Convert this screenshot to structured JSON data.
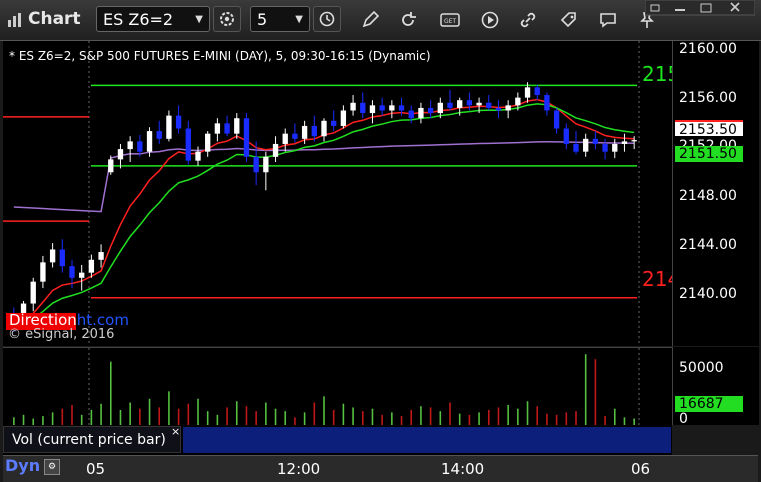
{
  "window": {
    "title": "Chart"
  },
  "toolbar": {
    "symbol_value": "ES Z6=2",
    "interval_value": "5",
    "buttons": [
      "settings-gear",
      "clock",
      "pencil-draw",
      "refresh",
      "get-quote",
      "play",
      "link",
      "comment",
      "pin"
    ]
  },
  "chart": {
    "info": "* ES Z6=2, S&P 500 FUTURES E-MINI (DAY), 5, 09:30-16:15 (Dynamic)",
    "watermark_a": "Direction",
    "watermark_b": "ht.com",
    "copyright": "© eSignal, 2016",
    "level_upper_label": "215",
    "level_lower_label": "214",
    "price_ticks": [
      "2160.00",
      "2156.00",
      "2152.00",
      "2148.00",
      "2144.00",
      "2140.00"
    ],
    "last_price": "2153.50",
    "level_price": "2151.50",
    "time_ticks": [
      "05",
      "12:00",
      "14:00",
      "06"
    ],
    "dynamic_label": "Dyn"
  },
  "volume": {
    "label": "Vol (current price bar)",
    "close": "×",
    "ticks": [
      "50000",
      "0"
    ],
    "last_volume": "16687"
  },
  "colors": {
    "up": "#ffffff",
    "down": "#1a2cff",
    "ema_red": "#ff2020",
    "ema_green": "#20e020",
    "vwap_purple": "#a070d0",
    "level_green": "#1ee61e",
    "level_red": "#ff2020",
    "vol_up": "#56c040",
    "vol_down": "#c01818"
  },
  "chart_data": {
    "type": "candlestick",
    "title": "ES Z6=2, S&P 500 FUTURES E-MINI (DAY), 5",
    "ylim": [
      2137.5,
      2161.2
    ],
    "levels": {
      "green_upper": 2157.75,
      "green_lower": 2151.5,
      "red_upper": 2155.3,
      "red_mid": 2147.2,
      "red_lower": 2141.25
    },
    "last_price": 2153.5,
    "candles": [
      [
        2139.8,
        2140.5,
        2138.6,
        2138.9
      ],
      [
        2139,
        2141,
        2138.8,
        2140.8
      ],
      [
        2140.8,
        2142.8,
        2140.2,
        2142.5
      ],
      [
        2142.5,
        2144.5,
        2142,
        2144
      ],
      [
        2144,
        2145.5,
        2143.6,
        2145
      ],
      [
        2145,
        2145.8,
        2143.2,
        2143.7
      ],
      [
        2143.7,
        2144.2,
        2142,
        2142.8
      ],
      [
        2142.8,
        2143.8,
        2141.8,
        2143.2
      ],
      [
        2143.2,
        2144.6,
        2142.8,
        2144.2
      ],
      [
        2144.2,
        2145.4,
        2143.6,
        2144.8
      ],
      [
        2151,
        2152.3,
        2150.8,
        2152
      ],
      [
        2152,
        2153.2,
        2151.3,
        2152.8
      ],
      [
        2152.8,
        2153.8,
        2151.8,
        2153.4
      ],
      [
        2153.4,
        2153.9,
        2152.2,
        2152.6
      ],
      [
        2152.6,
        2154.5,
        2152.2,
        2154.2
      ],
      [
        2154.2,
        2155,
        2153.2,
        2153.6
      ],
      [
        2153.6,
        2155.8,
        2153.4,
        2155.4
      ],
      [
        2155.4,
        2156.2,
        2154,
        2154.4
      ],
      [
        2154.4,
        2155,
        2151.6,
        2151.9
      ],
      [
        2151.9,
        2153,
        2151.5,
        2152.6
      ],
      [
        2152.6,
        2154.2,
        2152.2,
        2154
      ],
      [
        2154,
        2155.2,
        2153.4,
        2154.8
      ],
      [
        2154.8,
        2155.4,
        2153.8,
        2154
      ],
      [
        2154,
        2155.6,
        2153.6,
        2155.2
      ],
      [
        2155.2,
        2155.6,
        2151.8,
        2152.2
      ],
      [
        2152.2,
        2153.4,
        2150,
        2151
      ],
      [
        2151,
        2152.6,
        2149.6,
        2152.2
      ],
      [
        2152.2,
        2153.8,
        2151.8,
        2153.2
      ],
      [
        2153.2,
        2154.4,
        2152.6,
        2154
      ],
      [
        2154,
        2154.8,
        2153.3,
        2153.6
      ],
      [
        2153.6,
        2155,
        2153.2,
        2154.6
      ],
      [
        2154.6,
        2155.4,
        2153.4,
        2153.8
      ],
      [
        2153.8,
        2155.2,
        2153.4,
        2155
      ],
      [
        2155,
        2155.8,
        2154.2,
        2154.6
      ],
      [
        2154.6,
        2156.2,
        2154.4,
        2155.8
      ],
      [
        2155.8,
        2157,
        2155.4,
        2156.4
      ],
      [
        2156.4,
        2157.2,
        2155.2,
        2155.6
      ],
      [
        2155.6,
        2156.6,
        2154.8,
        2156.2
      ],
      [
        2156.2,
        2156.8,
        2155.4,
        2155.8
      ],
      [
        2155.8,
        2156.6,
        2155.2,
        2156.2
      ],
      [
        2156.2,
        2156.8,
        2155.4,
        2155.8
      ],
      [
        2155.8,
        2156.2,
        2154.8,
        2155.2
      ],
      [
        2155.2,
        2156.4,
        2154.8,
        2156
      ],
      [
        2156,
        2156.6,
        2155.2,
        2155.6
      ],
      [
        2155.6,
        2156.8,
        2155.2,
        2156.4
      ],
      [
        2156.4,
        2157.4,
        2155.8,
        2156
      ],
      [
        2156,
        2156.8,
        2155.4,
        2156.6
      ],
      [
        2156.6,
        2157.2,
        2155.8,
        2156.2
      ],
      [
        2156.2,
        2156.8,
        2155.6,
        2156.4
      ],
      [
        2156.4,
        2157,
        2155.8,
        2156
      ],
      [
        2156,
        2156.6,
        2155.2,
        2155.8
      ],
      [
        2155.8,
        2156.6,
        2155.2,
        2156.2
      ],
      [
        2156.2,
        2157.2,
        2155.8,
        2156.8
      ],
      [
        2156.8,
        2158,
        2156.4,
        2157.6
      ],
      [
        2157.6,
        2157.8,
        2156.6,
        2157
      ],
      [
        2157,
        2157.2,
        2155.4,
        2155.8
      ],
      [
        2155.8,
        2156,
        2154,
        2154.4
      ],
      [
        2154.4,
        2154.8,
        2152.8,
        2153.2
      ],
      [
        2153.2,
        2154.2,
        2152.4,
        2152.6
      ],
      [
        2152.6,
        2154,
        2152.2,
        2153.6
      ],
      [
        2153.6,
        2154.2,
        2152.8,
        2153.2
      ],
      [
        2153.2,
        2153.6,
        2152,
        2152.6
      ],
      [
        2152.6,
        2153.6,
        2152.1,
        2153.2
      ],
      [
        2153.2,
        2154,
        2152.6,
        2153.4
      ],
      [
        2153.4,
        2153.8,
        2152.8,
        2153.5
      ]
    ],
    "volume": [
      1400,
      1800,
      1200,
      1600,
      2200,
      2800,
      3400,
      1800,
      2600,
      3600,
      10400,
      2600,
      3800,
      2800,
      4400,
      3000,
      5600,
      2800,
      3600,
      4400,
      2400,
      1800,
      3000,
      4000,
      3200,
      2400,
      3800,
      2800,
      2400,
      1400,
      2200,
      3800,
      4800,
      2600,
      3600,
      3000,
      2400,
      2800,
      1800,
      2200,
      1600,
      2600,
      3200,
      3000,
      2400,
      3800,
      2000,
      1800,
      2200,
      2600,
      3000,
      3400,
      2800,
      4000,
      3200,
      2000,
      1800,
      2200,
      2400,
      11600,
      10800,
      1600,
      2800,
      1400,
      1200
    ],
    "volume_up": [
      true,
      true,
      true,
      true,
      true,
      false,
      false,
      true,
      true,
      true,
      true,
      true,
      true,
      false,
      true,
      false,
      true,
      false,
      false,
      true,
      true,
      true,
      false,
      true,
      false,
      false,
      true,
      true,
      true,
      false,
      true,
      false,
      true,
      false,
      true,
      true,
      false,
      true,
      false,
      true,
      false,
      false,
      true,
      false,
      true,
      false,
      true,
      false,
      true,
      false,
      false,
      true,
      true,
      true,
      false,
      false,
      false,
      false,
      false,
      true,
      false,
      false,
      true,
      true,
      true
    ],
    "volume_ylim": [
      0,
      58000
    ]
  }
}
